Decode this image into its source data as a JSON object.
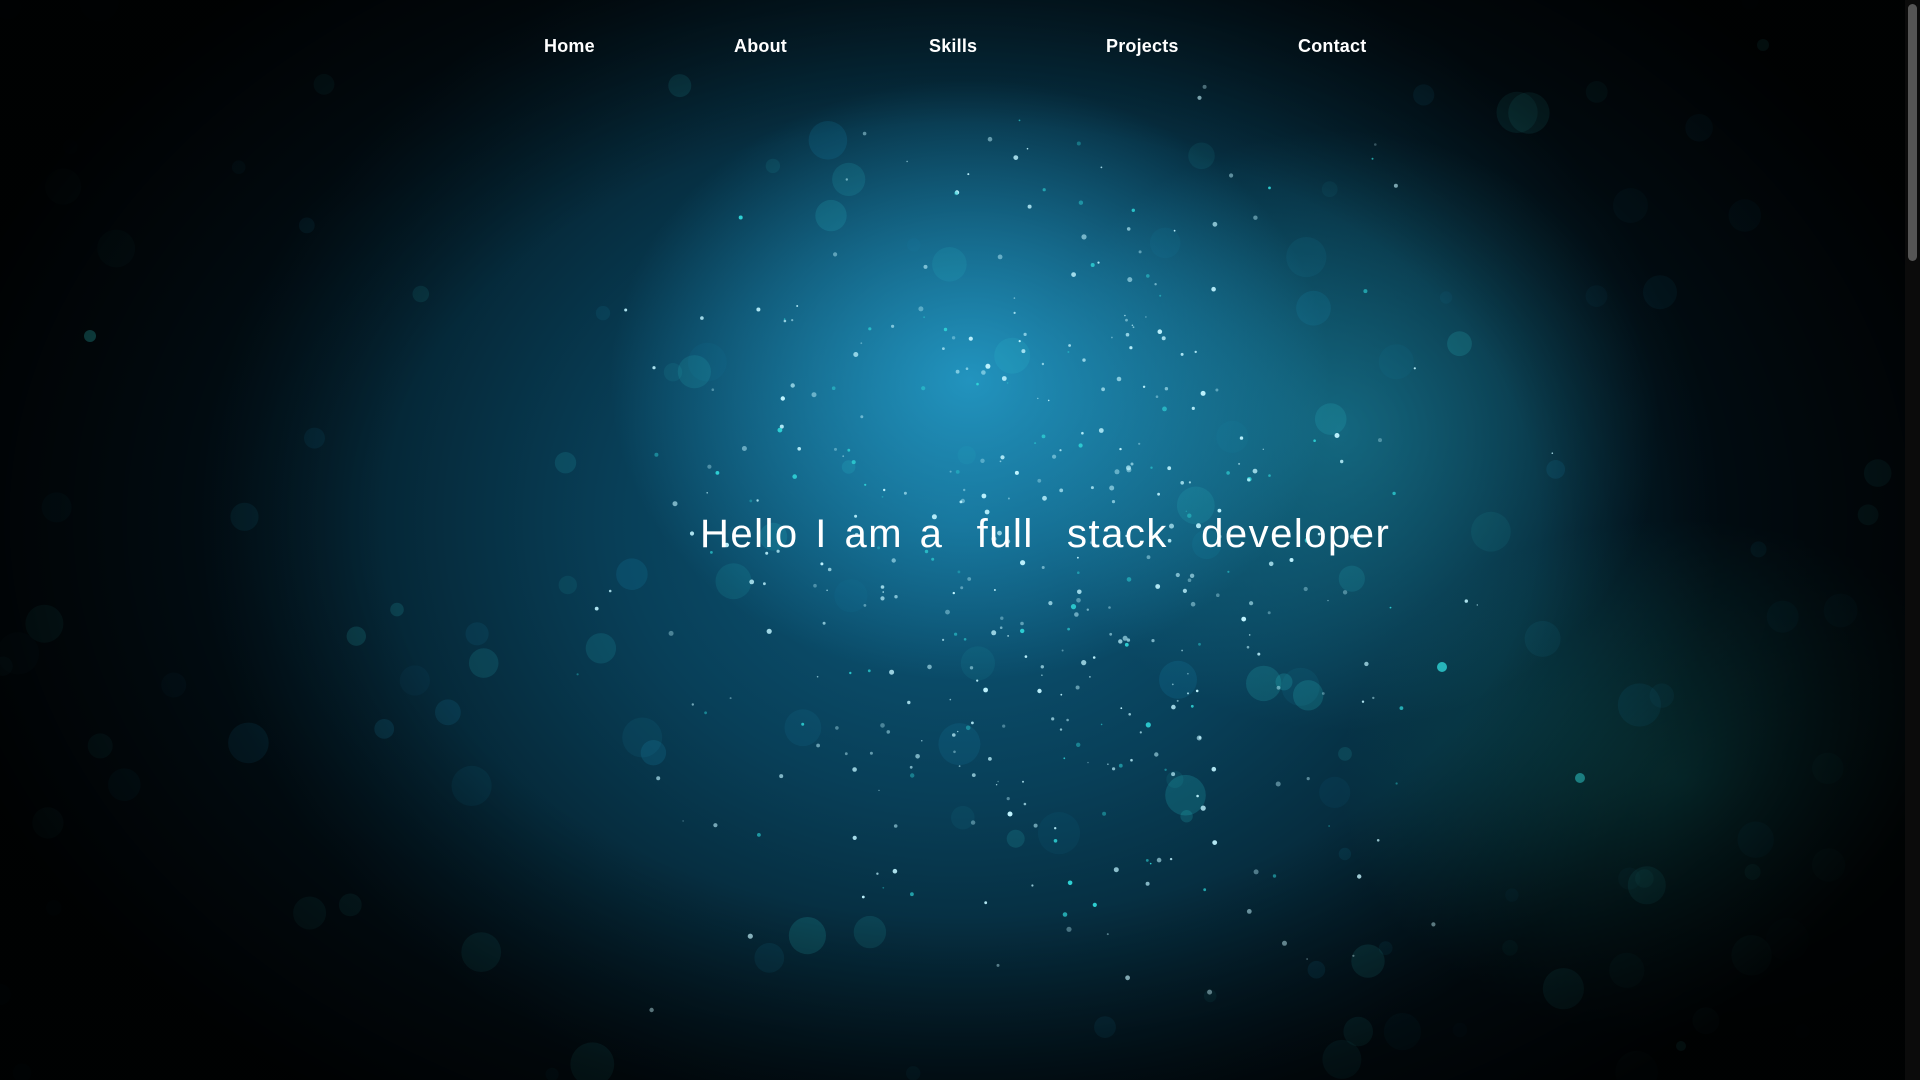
{
  "nav": {
    "items": [
      {
        "label": "Home"
      },
      {
        "label": "About"
      },
      {
        "label": "Skills"
      },
      {
        "label": "Projects"
      },
      {
        "label": "Contact"
      }
    ]
  },
  "hero": {
    "headline": "Hello I am a  full  stack  developer"
  },
  "colors": {
    "text": "#ffffff",
    "background_glow": "#26a0cd",
    "background_dark": "#02121b",
    "particle": "#bff4ff",
    "particle_teal": "#2fd3d6"
  }
}
